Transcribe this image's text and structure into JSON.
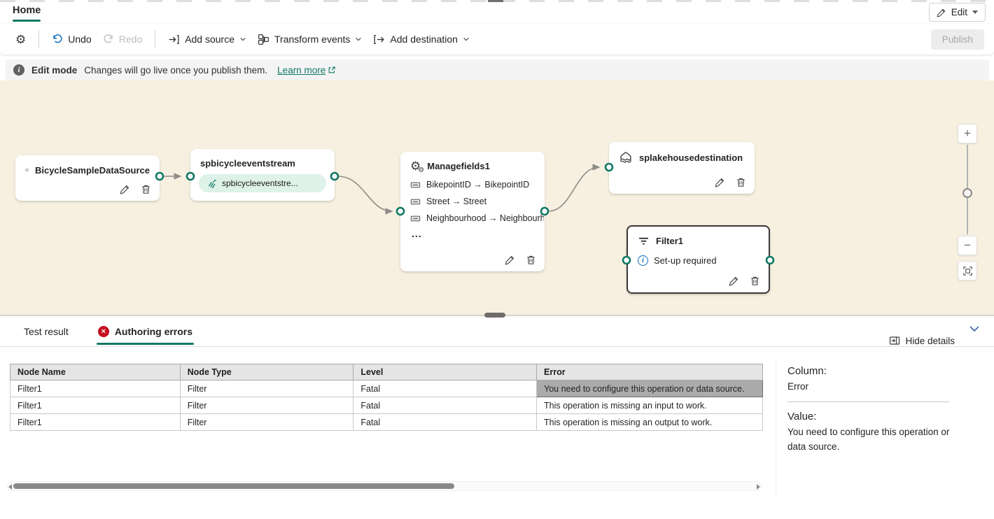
{
  "header": {
    "tab_label": "Home",
    "edit_label": "Edit"
  },
  "toolbar": {
    "undo_label": "Undo",
    "redo_label": "Redo",
    "add_source_label": "Add source",
    "transform_events_label": "Transform events",
    "add_destination_label": "Add destination",
    "publish_label": "Publish"
  },
  "banner": {
    "mode_label": "Edit mode",
    "message": "Changes will go live once you publish them.",
    "learn_more_label": "Learn more"
  },
  "canvas": {
    "nodes": {
      "source": {
        "title": "BicycleSampleDataSource"
      },
      "stream": {
        "title": "spbicycleeventstream",
        "pill_label": "spbicycleeventstre..."
      },
      "managefields": {
        "title": "Managefields1",
        "fields": [
          "BikepointID → BikepointID",
          "Street → Street",
          "Neighbourhood → Neighbourhood"
        ],
        "more_label": "..."
      },
      "destination": {
        "title": "splakehousedestination"
      },
      "filter": {
        "title": "Filter1",
        "status": "Set-up required"
      }
    },
    "zoom": {
      "in_label": "+",
      "out_label": "−"
    }
  },
  "panel": {
    "tabs": {
      "test_result": "Test result",
      "authoring_errors": "Authoring errors"
    },
    "error_badge": "×",
    "hide_details_label": "Hide details",
    "table": {
      "headers": [
        "Node Name",
        "Node Type",
        "Level",
        "Error"
      ],
      "rows": [
        [
          "Filter1",
          "Filter",
          "Fatal",
          "You need to configure this operation or data source."
        ],
        [
          "Filter1",
          "Filter",
          "Fatal",
          "This operation is missing an input to work."
        ],
        [
          "Filter1",
          "Filter",
          "Fatal",
          "This operation is missing an output to work."
        ]
      ]
    },
    "details": {
      "column_label": "Column:",
      "column_value": "Error",
      "value_label": "Value:",
      "value_text": "You need to configure this operation or data source."
    }
  },
  "colors": {
    "accent": "#117865",
    "error": "#c50f1f",
    "canvas_bg": "#f7f0e0",
    "info_blue": "#0f6cbd"
  }
}
